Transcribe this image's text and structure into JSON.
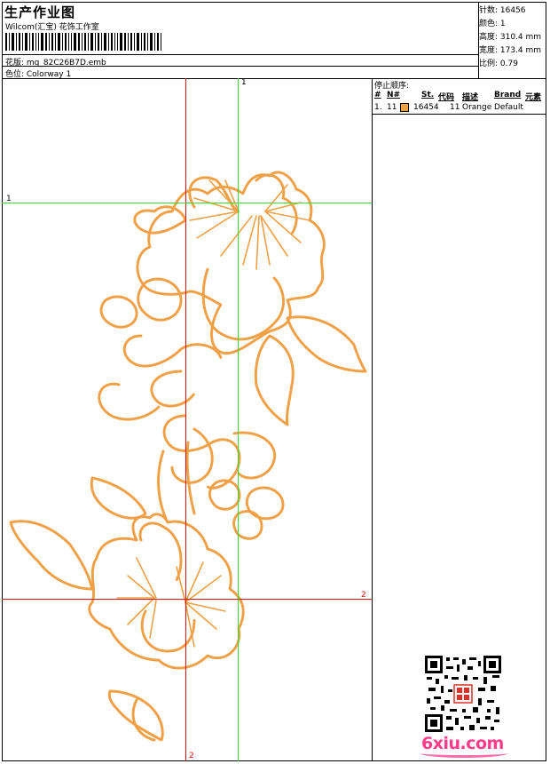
{
  "header": {
    "title": "生产作业图",
    "subtitle": "Wilcom(汇宝) 花饰工作室",
    "design_file": "花版: mg_82C26B7D.emb",
    "colorway": "色位: Colorway 1"
  },
  "stats": {
    "stitches": "针数: 16456",
    "colors": "颜色: 1",
    "height": "高度: 310.4 mm",
    "width": "宽度: 173.4 mm",
    "scale": "比例: 0.79"
  },
  "stop_sequence": {
    "title": "停止顺序:",
    "headers": {
      "num": "#",
      "n": "N#",
      "st": "St.",
      "code": "代码",
      "desc": "描述",
      "brand": "Brand",
      "elements": "元素"
    },
    "rows": [
      {
        "num": "1.",
        "n": "11",
        "st": "16454",
        "code": "11",
        "desc": "Orange",
        "brand": "Default",
        "color": "#f0a046"
      }
    ]
  },
  "guides": {
    "green_top": "1",
    "green_left": "1",
    "red_right": "2",
    "red_bottom": "2"
  },
  "watermark": {
    "text": "6xiu.com",
    "qr_stamp": "以绣为友"
  },
  "colors": {
    "thread": "#f0a046",
    "guide_green": "#33dd33",
    "guide_red": "#e01010",
    "brand": "#ff3b8a"
  }
}
